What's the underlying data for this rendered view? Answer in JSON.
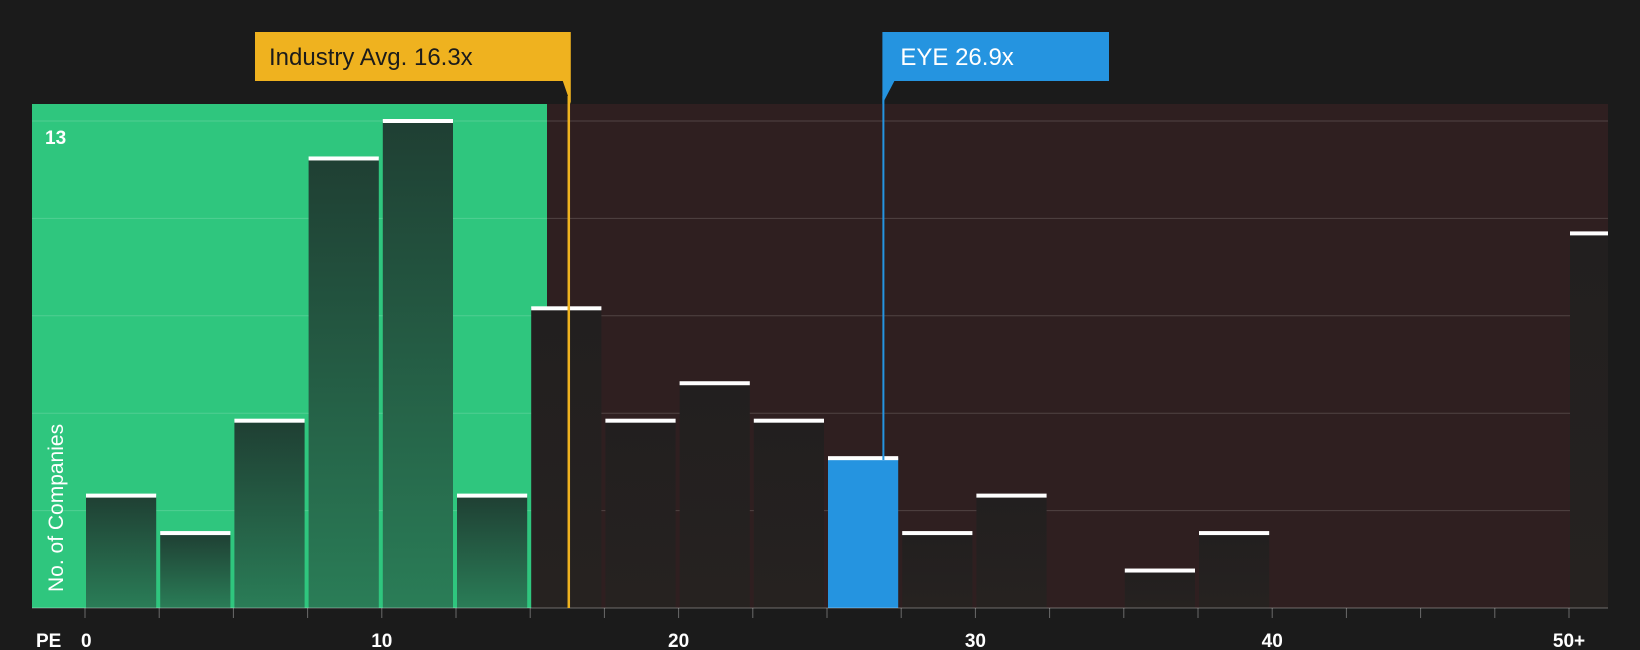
{
  "chart_data": {
    "type": "bar",
    "xlabel": "PE",
    "ylabel": "No. of Companies",
    "y_top_label": "13",
    "ylim": [
      0,
      13
    ],
    "x_ticks": [
      "0",
      "10",
      "20",
      "30",
      "40",
      "50+"
    ],
    "bin_width": 2.5,
    "bins": [
      {
        "start": 0,
        "value": 3
      },
      {
        "start": 2.5,
        "value": 2
      },
      {
        "start": 5,
        "value": 5
      },
      {
        "start": 7.5,
        "value": 12
      },
      {
        "start": 10,
        "value": 13
      },
      {
        "start": 12.5,
        "value": 3
      },
      {
        "start": 15,
        "value": 8
      },
      {
        "start": 17.5,
        "value": 5
      },
      {
        "start": 20,
        "value": 6
      },
      {
        "start": 22.5,
        "value": 5
      },
      {
        "start": 25,
        "value": 4,
        "highlight": true
      },
      {
        "start": 27.5,
        "value": 2
      },
      {
        "start": 30,
        "value": 3
      },
      {
        "start": 32.5,
        "value": 0
      },
      {
        "start": 35,
        "value": 1
      },
      {
        "start": 37.5,
        "value": 2
      },
      {
        "start": 40,
        "value": 0
      },
      {
        "start": 42.5,
        "value": 0
      },
      {
        "start": 45,
        "value": 0
      },
      {
        "start": 47.5,
        "value": 0
      },
      {
        "start": 50,
        "value": 10
      }
    ],
    "industry_avg": {
      "label": "Industry Avg. 16.3x",
      "value": 16.3
    },
    "company": {
      "label": "EYE 26.9x",
      "value": 26.9
    },
    "colors": {
      "background": "#1b1b1b",
      "undervalued_zone": "#2fc67e",
      "overvalued_zone": "#2f1f20",
      "bar_dark": "#23362d",
      "bar_dark_gradient_top": "#1f3d31",
      "bar_dark_gradient_bottom": "#2a7a55",
      "bar_neutral": "#241f1f",
      "highlight_bar": "#2594e0",
      "industry_callout": "#efb21f",
      "company_callout": "#2594e0",
      "bar_cap": "#ffffff"
    }
  }
}
